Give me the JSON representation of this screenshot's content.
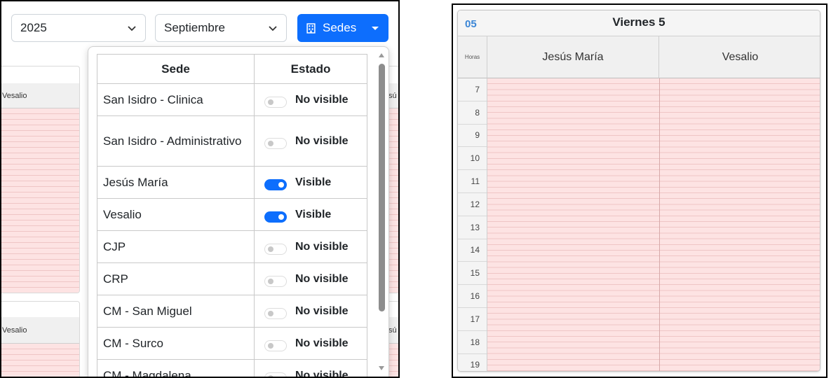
{
  "toolbar": {
    "year": "2025",
    "month": "Septiembre",
    "sedes_label": "Sedes"
  },
  "background_calendar": {
    "column_label": "Vesalio",
    "partial_label": "sú"
  },
  "sedes_dropdown": {
    "headers": {
      "sede": "Sede",
      "estado": "Estado"
    },
    "rows": [
      {
        "name": "San Isidro - Clinica",
        "visible": false,
        "state": "No visible"
      },
      {
        "name": "San Isidro - Administrativo",
        "visible": false,
        "state": "No visible"
      },
      {
        "name": "Jesús María",
        "visible": true,
        "state": "Visible"
      },
      {
        "name": "Vesalio",
        "visible": true,
        "state": "Visible"
      },
      {
        "name": "CJP",
        "visible": false,
        "state": "No visible"
      },
      {
        "name": "CRP",
        "visible": false,
        "state": "No visible"
      },
      {
        "name": "CM - San Miguel",
        "visible": false,
        "state": "No visible"
      },
      {
        "name": "CM - Surco",
        "visible": false,
        "state": "No visible"
      },
      {
        "name": "CM - Magdalena",
        "visible": false,
        "state": "No visible"
      }
    ]
  },
  "day_view": {
    "day_number": "05",
    "day_title": "Viernes 5",
    "hours_header": "Horas",
    "columns": [
      "Jesús María",
      "Vesalio"
    ],
    "hours": [
      "7",
      "8",
      "9",
      "10",
      "11",
      "12",
      "13",
      "14",
      "15",
      "16",
      "17",
      "18",
      "19"
    ]
  },
  "colors": {
    "primary": "#0d6efd",
    "slot_background": "#fde3e3",
    "day_number": "#3b86d6"
  }
}
